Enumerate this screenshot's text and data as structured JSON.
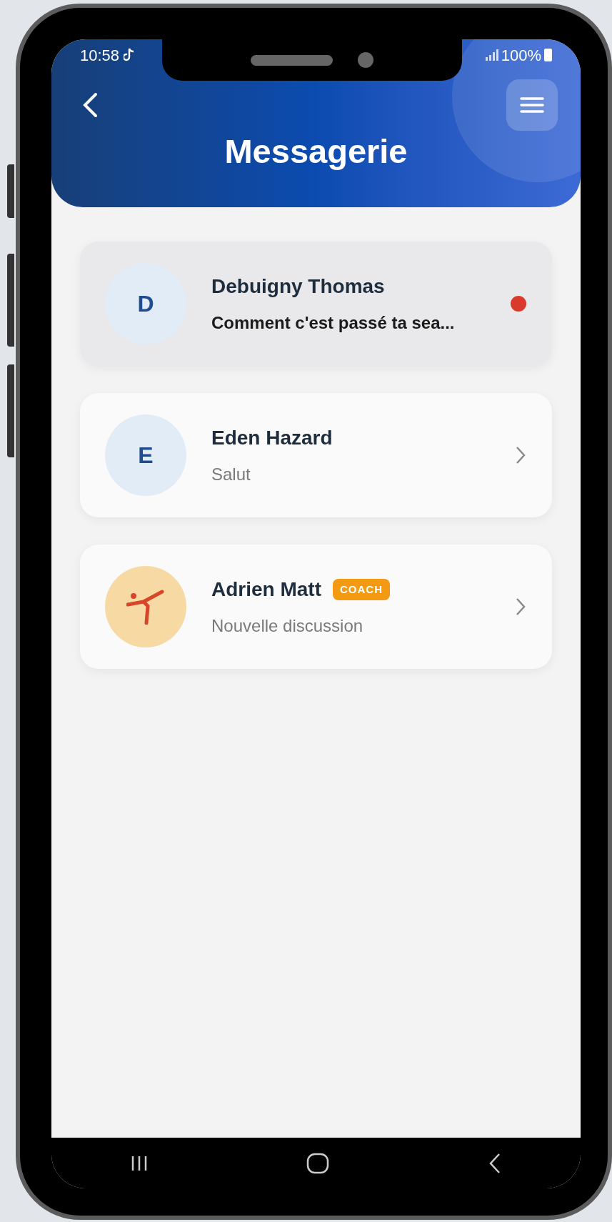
{
  "status_bar": {
    "time": "10:58",
    "battery": "100%"
  },
  "header": {
    "title": "Messagerie"
  },
  "conversations": [
    {
      "name": "Debuigny Thomas",
      "preview": "Comment c'est passé ta sea...",
      "unread": true,
      "avatar": {
        "kind": "initial",
        "text": "D"
      }
    },
    {
      "name": "Eden Hazard",
      "preview": "Salut",
      "unread": false,
      "avatar": {
        "kind": "initial",
        "text": "E"
      }
    },
    {
      "name": "Adrien Matt",
      "badge": "COACH",
      "preview": "Nouvelle discussion",
      "unread": false,
      "avatar": {
        "kind": "picture"
      }
    }
  ]
}
